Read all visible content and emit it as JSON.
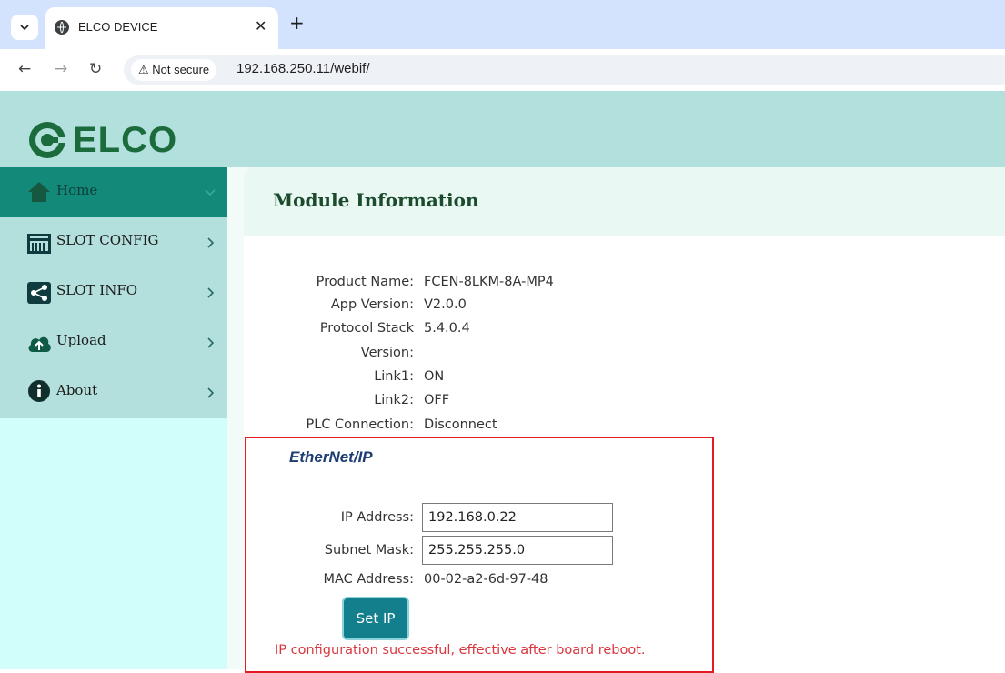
{
  "browser": {
    "tab_title": "ELCO DEVICE",
    "security_label": "Not secure",
    "url": "192.168.250.11/webif/"
  },
  "site": {
    "logo_text": "ELCO",
    "brand_color": "#1c6b3c",
    "header_color": "#b2e0dc"
  },
  "sidebar": {
    "items": [
      {
        "label": "Home",
        "icon": "home-icon",
        "active": true
      },
      {
        "label": "SLOT CONFIG",
        "icon": "slot-config-icon",
        "active": false
      },
      {
        "label": "SLOT INFO",
        "icon": "share-icon",
        "active": false
      },
      {
        "label": "Upload",
        "icon": "cloud-upload-icon",
        "active": false
      },
      {
        "label": "About",
        "icon": "info-icon",
        "active": false
      }
    ]
  },
  "main": {
    "title": "Module Information",
    "info": [
      {
        "label": "Product Name:",
        "value": "FCEN-8LKM-8A-MP4"
      },
      {
        "label": "App Version:",
        "value": "V2.0.0"
      },
      {
        "label": "Protocol Stack",
        "label2": "Version:",
        "value": "5.4.0.4"
      },
      {
        "label": "Link1:",
        "value": "ON"
      },
      {
        "label": "Link2:",
        "value": "OFF"
      },
      {
        "label": "PLC Connection:",
        "value": "Disconnect"
      }
    ],
    "ethernet_ip": {
      "logo_text": "EtherNet/IP",
      "ip_label": "IP Address:",
      "ip_value": "192.168.0.22",
      "mask_label": "Subnet Mask:",
      "mask_value": "255.255.255.0",
      "mac_label": "MAC Address:",
      "mac_value": "00-02-a2-6d-97-48",
      "button_label": "Set IP",
      "message": "IP configuration successful, effective after board reboot.",
      "message_color": "#d9363e",
      "highlight_color": "#e31b23"
    }
  }
}
